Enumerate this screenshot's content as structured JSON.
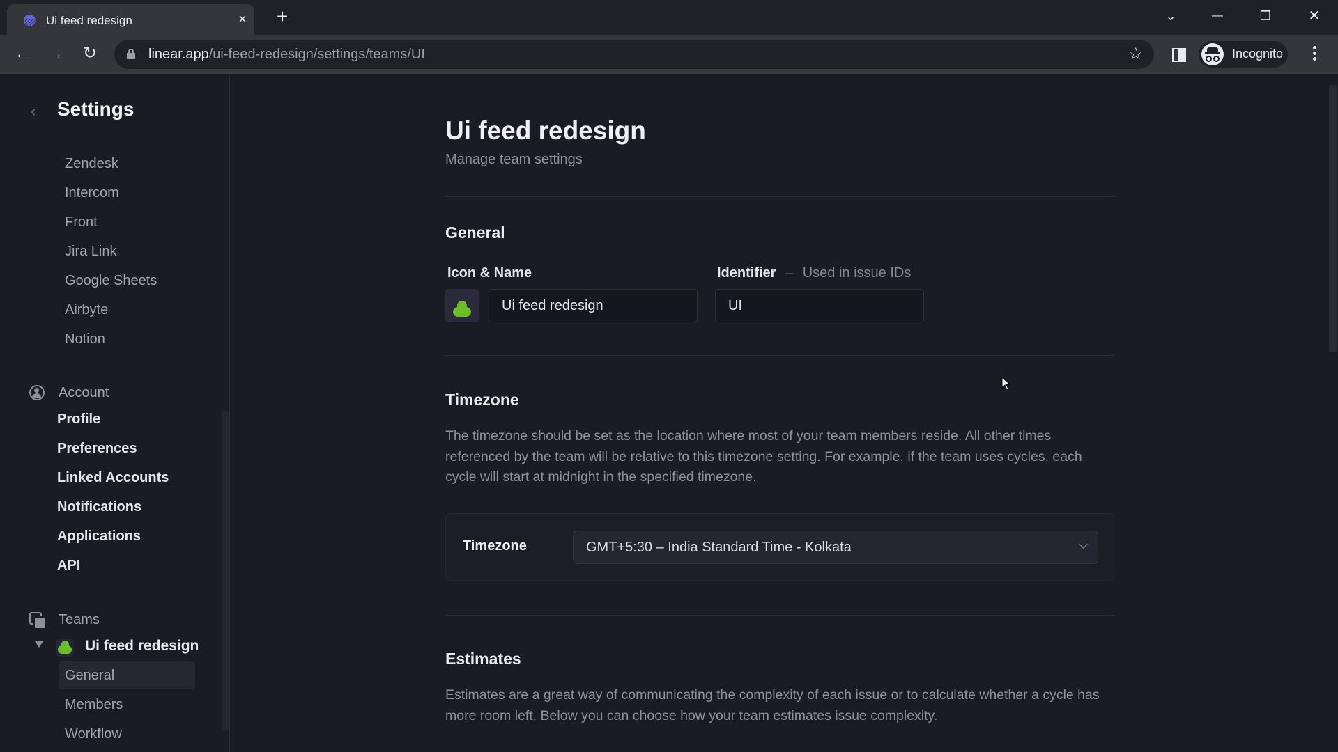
{
  "browser": {
    "tab_title": "Ui feed redesign",
    "tab_close": "×",
    "new_tab": "+",
    "url_host": "linear.app",
    "url_path": "/ui-feed-redesign/settings/teams/UI",
    "profile_label": "Incognito",
    "icons": {
      "back": "←",
      "forward": "→",
      "reload": "↻",
      "bookmark": "☆",
      "tab_search": "⌄",
      "minimize": "—",
      "restore": "❐",
      "close": "✕"
    }
  },
  "sidebar": {
    "back_icon": "‹",
    "title": "Settings",
    "integrations": [
      "Zendesk",
      "Intercom",
      "Front",
      "Jira Link",
      "Google Sheets",
      "Airbyte",
      "Notion"
    ],
    "account": {
      "label": "Account",
      "items": [
        "Profile",
        "Preferences",
        "Linked Accounts",
        "Notifications",
        "Applications",
        "API"
      ]
    },
    "teams": {
      "label": "Teams",
      "team_name": "Ui feed redesign",
      "team_color": "#6bbf26",
      "items": [
        "General",
        "Members",
        "Workflow"
      ],
      "active_item": "General"
    }
  },
  "main": {
    "title": "Ui feed redesign",
    "subtitle": "Manage team settings",
    "general": {
      "heading": "General",
      "icon_name_label": "Icon & Name",
      "name_value": "Ui feed redesign",
      "identifier_label": "Identifier",
      "identifier_sep": "–",
      "identifier_hint": "Used in issue IDs",
      "identifier_value": "UI"
    },
    "timezone": {
      "heading": "Timezone",
      "description": "The timezone should be set as the location where most of your team members reside. All other times referenced by the team will be relative to this timezone setting. For example, if the team uses cycles, each cycle will start at midnight in the specified timezone.",
      "field_label": "Timezone",
      "selected": "GMT+5:30 – India Standard Time - Kolkata"
    },
    "estimates": {
      "heading": "Estimates",
      "description": "Estimates are a great way of communicating the complexity of each issue or to calculate whether a cycle has more room left. Below you can choose how your team estimates issue complexity."
    }
  }
}
